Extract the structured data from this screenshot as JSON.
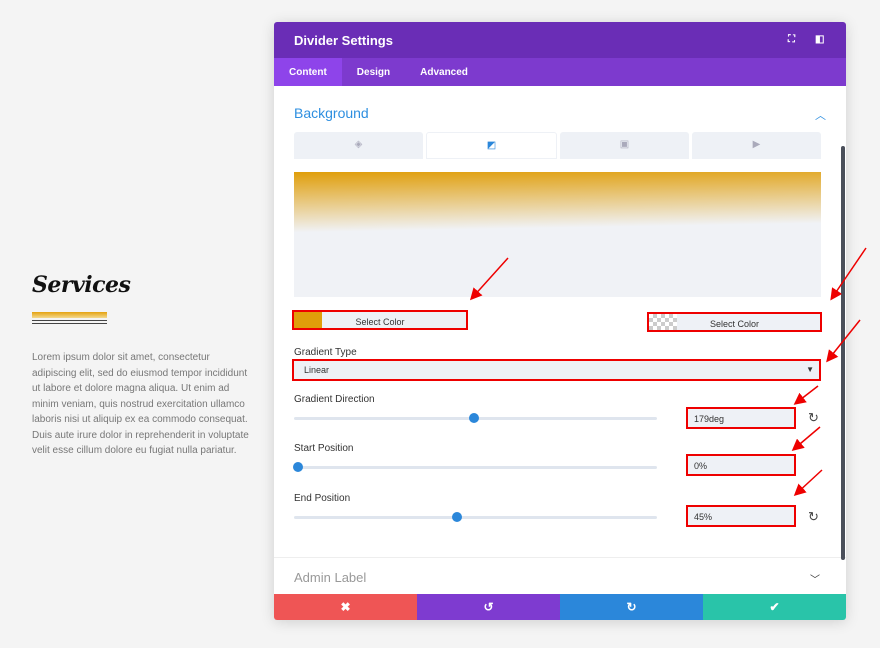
{
  "page": {
    "heading": "Services",
    "body": "Lorem ipsum dolor sit amet, consectetur adipiscing elit, sed do eiusmod tempor incididunt ut labore et dolore magna aliqua. Ut enim ad minim veniam, quis nostrud exercitation ullamco laboris nisi ut aliquip ex ea commodo consequat. Duis aute irure dolor in reprehenderit in voluptate velit esse cillum dolore eu fugiat nulla pariatur."
  },
  "modal": {
    "title": "Divider Settings",
    "tabs": [
      "Content",
      "Design",
      "Advanced"
    ],
    "section": "Background",
    "bg_tabs": [
      "paint-bucket-icon",
      "gradient-icon",
      "image-icon",
      "video-icon"
    ],
    "color1": {
      "label": "Select Color",
      "swatch": "#e09e0a"
    },
    "color2": {
      "label": "Select Color",
      "swatch": "transparent"
    },
    "gradient_type": {
      "label": "Gradient Type",
      "value": "Linear"
    },
    "gradient_direction": {
      "label": "Gradient Direction",
      "value": "179deg",
      "slider": 0.5
    },
    "start_position": {
      "label": "Start Position",
      "value": "0%",
      "slider": 0
    },
    "end_position": {
      "label": "End Position",
      "value": "45%",
      "slider": 0.45
    },
    "admin_label": "Admin Label",
    "footer": {
      "cancel": "✖",
      "undo": "↺",
      "redo": "↻",
      "save": "✔"
    },
    "colors": {
      "header": "#6a2db6",
      "tabs": "#7d3ace",
      "accent": "#2b87da",
      "cancel": "#ef5555",
      "undo": "#7e3bd0",
      "redo": "#2b87da",
      "save": "#29c4a9"
    }
  }
}
